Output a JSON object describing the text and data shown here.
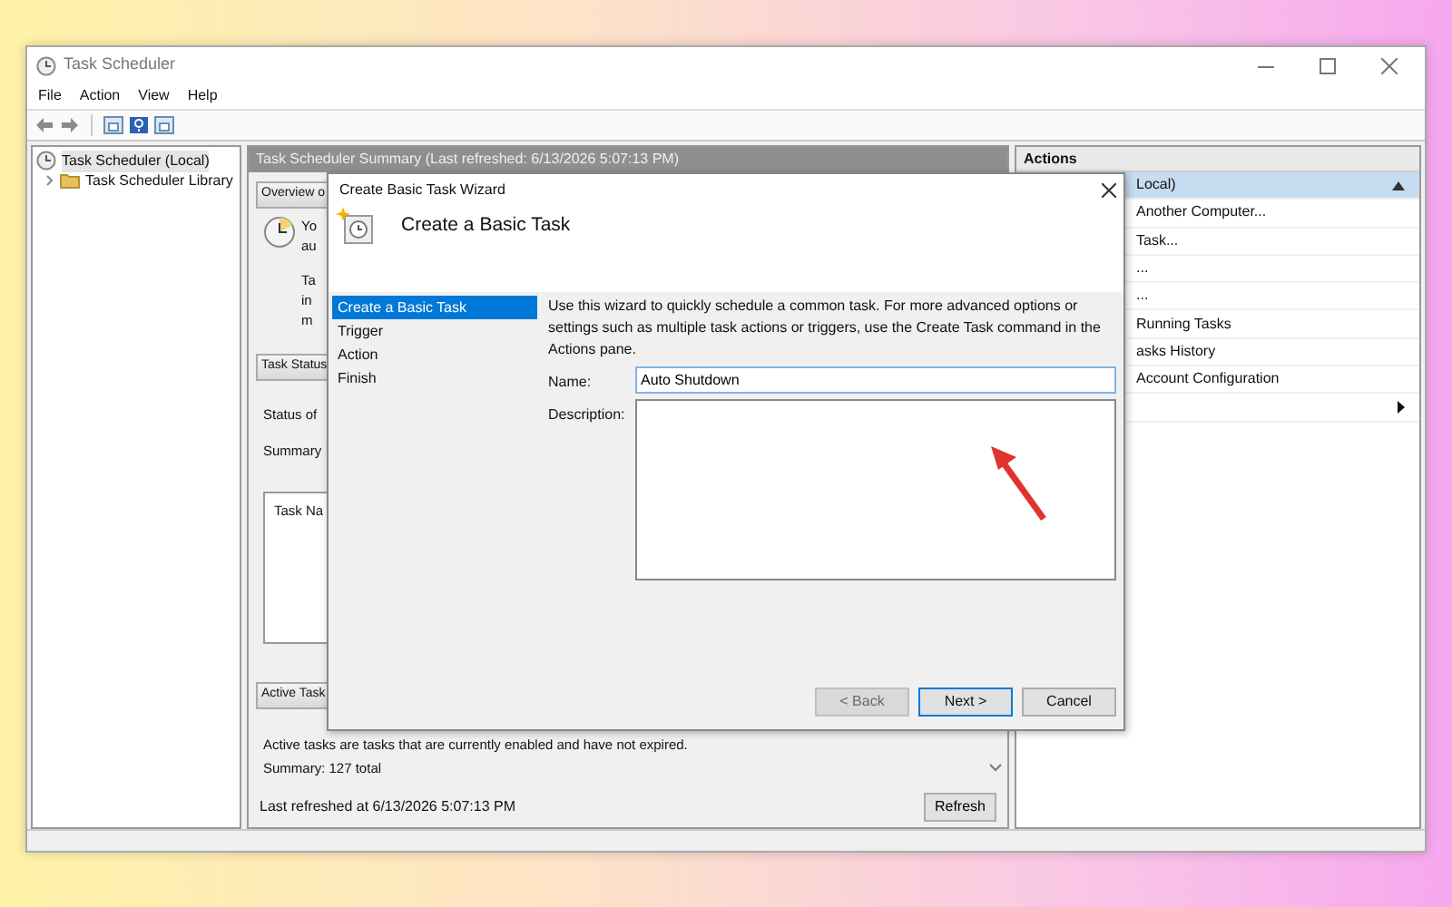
{
  "window": {
    "title": "Task Scheduler"
  },
  "menu": [
    "File",
    "Action",
    "View",
    "Help"
  ],
  "tree": [
    {
      "label": "Task Scheduler (Local)",
      "selected": true,
      "children": [
        {
          "label": "Task Scheduler Library",
          "selected": false,
          "expanded": false
        }
      ]
    }
  ],
  "summary": {
    "header": "Task Scheduler Summary (Last refreshed: 6/13/2026 5:07:13 PM)",
    "overview": {
      "title": "Overview o",
      "intro_lines": [
        "Yo",
        "au"
      ],
      "detail_lines": [
        "Ta",
        "in",
        "m"
      ]
    },
    "status": {
      "title": "Task Status",
      "lines": [
        "Status of",
        "Summary"
      ],
      "table_header": "Task Na"
    },
    "active": {
      "title": "Active Task",
      "text": "Active tasks are tasks that are currently enabled and have not expired.",
      "summary": "Summary: 127 total"
    },
    "footer": {
      "text": "Last refreshed at 6/13/2026 5:07:13 PM",
      "button": "Refresh"
    }
  },
  "actions": {
    "title": "Actions",
    "items": [
      {
        "kind": "group",
        "label": "Local)",
        "selected": true
      },
      {
        "kind": "item",
        "label": "Another Computer...",
        "selected": false
      },
      {
        "kind": "item",
        "label": "Task...",
        "selected": false
      },
      {
        "kind": "item",
        "label": "...",
        "selected": false
      },
      {
        "kind": "item",
        "label": "...",
        "selected": false
      },
      {
        "kind": "item",
        "label": "Running Tasks",
        "selected": false
      },
      {
        "kind": "item",
        "label": "asks History",
        "selected": false
      },
      {
        "kind": "item",
        "label": "Account Configuration",
        "selected": false
      },
      {
        "kind": "submenu",
        "selected": false
      }
    ]
  },
  "dialog": {
    "title": "Create Basic Task Wizard",
    "heading": "Create a Basic Task",
    "steps": [
      {
        "label": "Create a Basic Task",
        "selected": true
      },
      {
        "label": "Trigger",
        "selected": false
      },
      {
        "label": "Action",
        "selected": false
      },
      {
        "label": "Finish",
        "selected": false
      }
    ],
    "intro": "Use this wizard to quickly schedule a common task.  For more advanced options or settings such as multiple task actions or triggers, use the Create Task command in the Actions pane.",
    "name_label": "Name:",
    "name_value": "Auto Shutdown",
    "description_label": "Description:",
    "buttons": [
      {
        "label": "< Back",
        "disabled": true,
        "default": false
      },
      {
        "label": "Next >",
        "disabled": false,
        "default": true
      },
      {
        "label": "Cancel",
        "disabled": false,
        "default": false
      }
    ]
  }
}
